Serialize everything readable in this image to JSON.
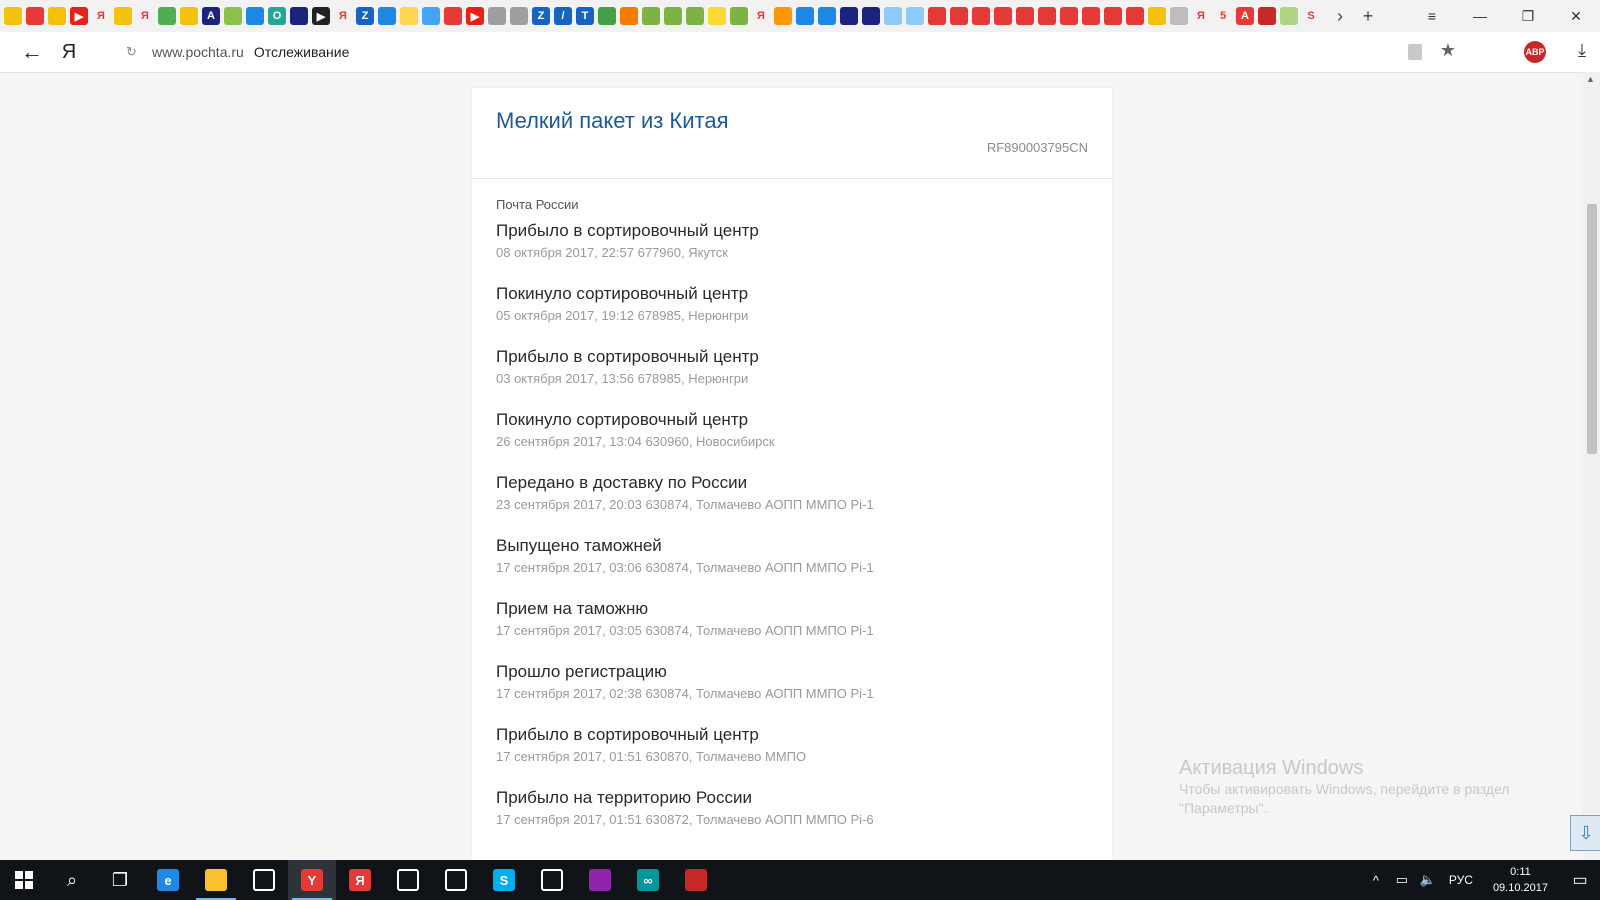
{
  "browser": {
    "tab_icons": [
      {
        "name": "pencil",
        "color": "#f4c20d",
        "glyph": ""
      },
      {
        "name": "mail",
        "color": "#e53935",
        "glyph": ""
      },
      {
        "name": "pencil",
        "color": "#f4c20d",
        "glyph": ""
      },
      {
        "name": "youtube",
        "color": "#e62117",
        "glyph": "▶"
      },
      {
        "name": "yandex",
        "color": "#ffffff",
        "glyph": "Я"
      },
      {
        "name": "landscape",
        "color": "#f4c20d",
        "glyph": ""
      },
      {
        "name": "yandex",
        "color": "#ffffff",
        "glyph": "Я"
      },
      {
        "name": "windows",
        "color": "#4caf50",
        "glyph": ""
      },
      {
        "name": "landscape",
        "color": "#f4c20d",
        "glyph": ""
      },
      {
        "name": "a-letter",
        "color": "#1a237e",
        "glyph": "A"
      },
      {
        "name": "plant",
        "color": "#8bc34a",
        "glyph": ""
      },
      {
        "name": "dropbox",
        "color": "#1e88e5",
        "glyph": ""
      },
      {
        "name": "o-letter",
        "color": "#26a69a",
        "glyph": "O"
      },
      {
        "name": "check",
        "color": "#1a237e",
        "glyph": ""
      },
      {
        "name": "play",
        "color": "#212121",
        "glyph": "▶"
      },
      {
        "name": "yandex",
        "color": "#ffffff",
        "glyph": "Я"
      },
      {
        "name": "z-letter",
        "color": "#1565c0",
        "glyph": "Z"
      },
      {
        "name": "pin",
        "color": "#1e88e5",
        "glyph": ""
      },
      {
        "name": "folder",
        "color": "#ffd54f",
        "glyph": ""
      },
      {
        "name": "doc",
        "color": "#42a5f5",
        "glyph": ""
      },
      {
        "name": "news",
        "color": "#e53935",
        "glyph": ""
      },
      {
        "name": "youtube",
        "color": "#e62117",
        "glyph": "▶"
      },
      {
        "name": "grid",
        "color": "#9e9e9e",
        "glyph": ""
      },
      {
        "name": "grid",
        "color": "#9e9e9e",
        "glyph": ""
      },
      {
        "name": "z-letter",
        "color": "#1565c0",
        "glyph": "Z"
      },
      {
        "name": "slash",
        "color": "#1565c0",
        "glyph": "/"
      },
      {
        "name": "tek",
        "color": "#1565c0",
        "glyph": "Т"
      },
      {
        "name": "bubble",
        "color": "#43a047",
        "glyph": ""
      },
      {
        "name": "flag",
        "color": "#f57c00",
        "glyph": ""
      },
      {
        "name": "plant",
        "color": "#7cb342",
        "glyph": ""
      },
      {
        "name": "plant",
        "color": "#7cb342",
        "glyph": ""
      },
      {
        "name": "plant",
        "color": "#7cb342",
        "glyph": ""
      },
      {
        "name": "lemon",
        "color": "#fdd835",
        "glyph": ""
      },
      {
        "name": "plant",
        "color": "#7cb342",
        "glyph": ""
      },
      {
        "name": "yandex",
        "color": "#ffffff",
        "glyph": "Я"
      },
      {
        "name": "box",
        "color": "#ff9800",
        "glyph": ""
      },
      {
        "name": "cube",
        "color": "#1e88e5",
        "glyph": ""
      },
      {
        "name": "cube",
        "color": "#1e88e5",
        "glyph": ""
      },
      {
        "name": "eagle",
        "color": "#1a237e",
        "glyph": ""
      },
      {
        "name": "eagle",
        "color": "#1a237e",
        "glyph": ""
      },
      {
        "name": "cart",
        "color": "#90caf9",
        "glyph": ""
      },
      {
        "name": "cart",
        "color": "#90caf9",
        "glyph": ""
      },
      {
        "name": "mail",
        "color": "#e53935",
        "glyph": ""
      },
      {
        "name": "mail",
        "color": "#e53935",
        "glyph": ""
      },
      {
        "name": "mail",
        "color": "#e53935",
        "glyph": ""
      },
      {
        "name": "mail",
        "color": "#e53935",
        "glyph": ""
      },
      {
        "name": "mail",
        "color": "#e53935",
        "glyph": ""
      },
      {
        "name": "mail",
        "color": "#e53935",
        "glyph": ""
      },
      {
        "name": "mail",
        "color": "#e53935",
        "glyph": ""
      },
      {
        "name": "mail",
        "color": "#e53935",
        "glyph": ""
      },
      {
        "name": "mail",
        "color": "#e53935",
        "glyph": ""
      },
      {
        "name": "mail",
        "color": "#e53935",
        "glyph": ""
      },
      {
        "name": "pencil",
        "color": "#f4c20d",
        "glyph": ""
      },
      {
        "name": "doc",
        "color": "#bdbdbd",
        "glyph": ""
      },
      {
        "name": "yandex",
        "color": "#ffffff",
        "glyph": "Я"
      },
      {
        "name": "five",
        "color": "#ffffff",
        "glyph": "5"
      },
      {
        "name": "a-letter",
        "color": "#e53935",
        "glyph": "A"
      },
      {
        "name": "power",
        "color": "#c62828",
        "glyph": ""
      },
      {
        "name": "chart",
        "color": "#aed581",
        "glyph": ""
      },
      {
        "name": "s-letter",
        "color": "#ffffff",
        "glyph": "S"
      }
    ],
    "url_domain": "www.pochta.ru",
    "url_title": "Отслеживание",
    "yandex_glyph": "Я",
    "adblock_label": "ABP"
  },
  "tracking": {
    "title": "Мелкий пакет из Китая",
    "number": "RF890003795CN",
    "carrier": "Почта России",
    "events": [
      {
        "title": "Прибыло в сортировочный центр",
        "meta": "08 октября 2017, 22:57 677960, Якутск"
      },
      {
        "title": "Покинуло сортировочный центр",
        "meta": "05 октября 2017, 19:12 678985, Нерюнгри"
      },
      {
        "title": "Прибыло в сортировочный центр",
        "meta": "03 октября 2017, 13:56 678985, Нерюнгри"
      },
      {
        "title": "Покинуло сортировочный центр",
        "meta": "26 сентября 2017, 13:04 630960, Новосибирск"
      },
      {
        "title": "Передано в доставку по России",
        "meta": "23 сентября 2017, 20:03 630874, Толмачево АОПП ММПО Pi-1"
      },
      {
        "title": "Выпущено таможней",
        "meta": "17 сентября 2017, 03:06 630874, Толмачево АОПП ММПО Pi-1"
      },
      {
        "title": "Прием на таможню",
        "meta": "17 сентября 2017, 03:05 630874, Толмачево АОПП ММПО Pi-1"
      },
      {
        "title": "Прошло регистрацию",
        "meta": "17 сентября 2017, 02:38 630874, Толмачево АОПП ММПО Pi-1"
      },
      {
        "title": "Прибыло в сортировочный центр",
        "meta": "17 сентября 2017, 01:51 630870, Толмачево ММПО"
      },
      {
        "title": "Прибыло на территорию России",
        "meta": "17 сентября 2017, 01:51 630872, Толмачево АОПП ММПО Pi-6"
      }
    ]
  },
  "watermark": {
    "title": "Активация Windows",
    "line1": "Чтобы активировать Windows, перейдите в раздел",
    "line2": "\"Параметры\"."
  },
  "taskbar": {
    "apps": [
      {
        "name": "edge",
        "color": "#1e88e5",
        "glyph": "e",
        "active": false,
        "running": false
      },
      {
        "name": "file-explorer",
        "color": "#fbc02d",
        "glyph": "",
        "active": false,
        "running": true
      },
      {
        "name": "store",
        "color": "#ffffff",
        "glyph": "",
        "active": false,
        "running": false
      },
      {
        "name": "yandex-browser",
        "color": "#e53935",
        "glyph": "Y",
        "active": true,
        "running": true
      },
      {
        "name": "yandex",
        "color": "#e53935",
        "glyph": "Я",
        "active": false,
        "running": false
      },
      {
        "name": "movie-maker",
        "color": "#ffffff",
        "glyph": "",
        "active": false,
        "running": false
      },
      {
        "name": "mail",
        "color": "#ffffff",
        "glyph": "",
        "active": false,
        "running": false
      },
      {
        "name": "skype",
        "color": "#00aff0",
        "glyph": "S",
        "active": false,
        "running": false
      },
      {
        "name": "settings",
        "color": "#ffffff",
        "glyph": "",
        "active": false,
        "running": false
      },
      {
        "name": "winrar",
        "color": "#8e24aa",
        "glyph": "",
        "active": false,
        "running": false
      },
      {
        "name": "arduino",
        "color": "#00979d",
        "glyph": "∞",
        "active": false,
        "running": false
      },
      {
        "name": "paint",
        "color": "#c62828",
        "glyph": "",
        "active": false,
        "running": false
      }
    ],
    "language": "РУС",
    "time": "0:11",
    "date": "09.10.2017"
  },
  "colors": {
    "title_blue": "#1f5a96",
    "meta_gray": "#9a9a9a",
    "page_bg": "#f5f5f5"
  }
}
